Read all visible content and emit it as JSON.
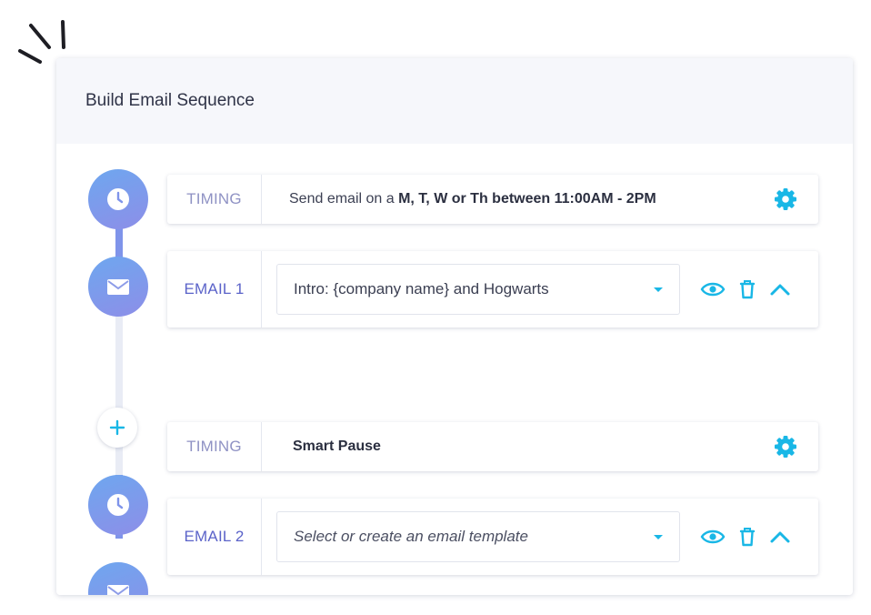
{
  "panel": {
    "title": "Build Email Sequence"
  },
  "steps": [
    {
      "type": "timing",
      "label": "TIMING",
      "text_prefix": "Send email on a ",
      "text_bold": "M, T, W or Th between 11:00AM - 2PM",
      "icon": "gear-icon"
    },
    {
      "type": "email",
      "label": "EMAIL 1",
      "template_value": "Intro: {company name} and Hogwarts",
      "actions": [
        "eye-icon",
        "trash-icon",
        "chevron-up-icon"
      ]
    },
    {
      "type": "timing",
      "label": "TIMING",
      "text": "Smart Pause",
      "icon": "gear-icon"
    },
    {
      "type": "email",
      "label": "EMAIL 2",
      "template_placeholder": "Select or create an email template",
      "actions": [
        "eye-icon",
        "trash-icon",
        "chevron-up-icon"
      ]
    }
  ],
  "colors": {
    "accent": "#19b7e6",
    "node_gradient_start": "#6ea7ef",
    "node_gradient_end": "#8d8ee8",
    "label_timing": "#8f92c4",
    "label_email": "#5b63c9"
  }
}
